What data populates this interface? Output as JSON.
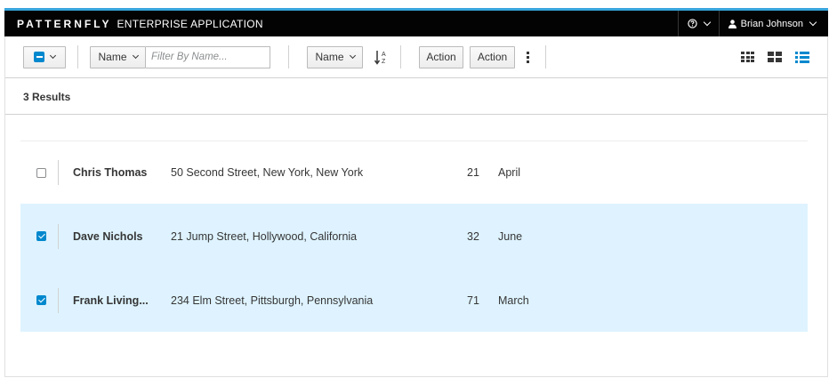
{
  "masthead": {
    "brand_bold": "PATTERNFLY",
    "brand_light": "ENTERPRISE APPLICATION",
    "help_icon": "question-circle-icon",
    "user_icon": "user-icon",
    "user_name": "Brian Johnson"
  },
  "toolbar": {
    "filter_field": "Name",
    "filter_placeholder": "Filter By Name...",
    "sort_field": "Name",
    "sort_icon": "sort-alpha-asc-icon",
    "action1_label": "Action",
    "action2_label": "Action",
    "kebab_icon": "kebab-icon",
    "views": [
      "small-icons-view-icon",
      "large-icons-view-icon",
      "list-view-icon"
    ],
    "active_view": "list-view-icon",
    "accent_color": "#0088ce"
  },
  "results": {
    "count_label": "3 Results"
  },
  "list": {
    "selected_bg": "#def3ff",
    "items": [
      {
        "name": "Chris Thomas",
        "address": "50 Second Street, New York, New York",
        "age": "21",
        "month": "April",
        "selected": false
      },
      {
        "name": "Dave Nichols",
        "address": "21 Jump Street, Hollywood, California",
        "age": "32",
        "month": "June",
        "selected": true
      },
      {
        "name": "Frank Living...",
        "address": "234 Elm Street, Pittsburgh, Pennsylvania",
        "age": "71",
        "month": "March",
        "selected": true
      }
    ]
  }
}
